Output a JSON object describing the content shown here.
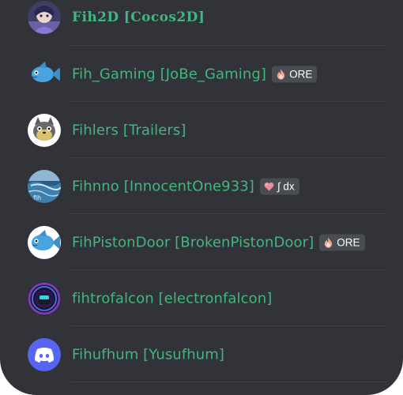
{
  "members": [
    {
      "name": "Fih2D [Cocos2D]",
      "avatar": "anime-character-avatar",
      "tag": null
    },
    {
      "name": "Fih_Gaming [JoBe_Gaming]",
      "avatar": "blue-fish-avatar",
      "tag": {
        "icon": "fire-icon",
        "label": "ORE"
      }
    },
    {
      "name": "Fihlers [Trailers]",
      "avatar": "cartoon-cat-avatar",
      "tag": null
    },
    {
      "name": "Fihnno [InnocentOne933]",
      "avatar": "ocean-photo-avatar",
      "tag": {
        "icon": "heart-icon",
        "label": "∫ dx"
      }
    },
    {
      "name": "FihPistonDoor [BrokenPistonDoor]",
      "avatar": "blue-fish-avatar",
      "tag": {
        "icon": "fire-icon",
        "label": "ORE"
      }
    },
    {
      "name": "fihtrofalcon [electronfalcon]",
      "avatar": "vortex-helmet-avatar",
      "tag": null
    },
    {
      "name": "Fihufhum [Yusufhum]",
      "avatar": "discord-logo-avatar",
      "tag": null
    }
  ],
  "colors": {
    "background": "#313338",
    "name": "#43b581",
    "tag_background": "#4a4c53",
    "discord_blurple": "#5865f2"
  }
}
